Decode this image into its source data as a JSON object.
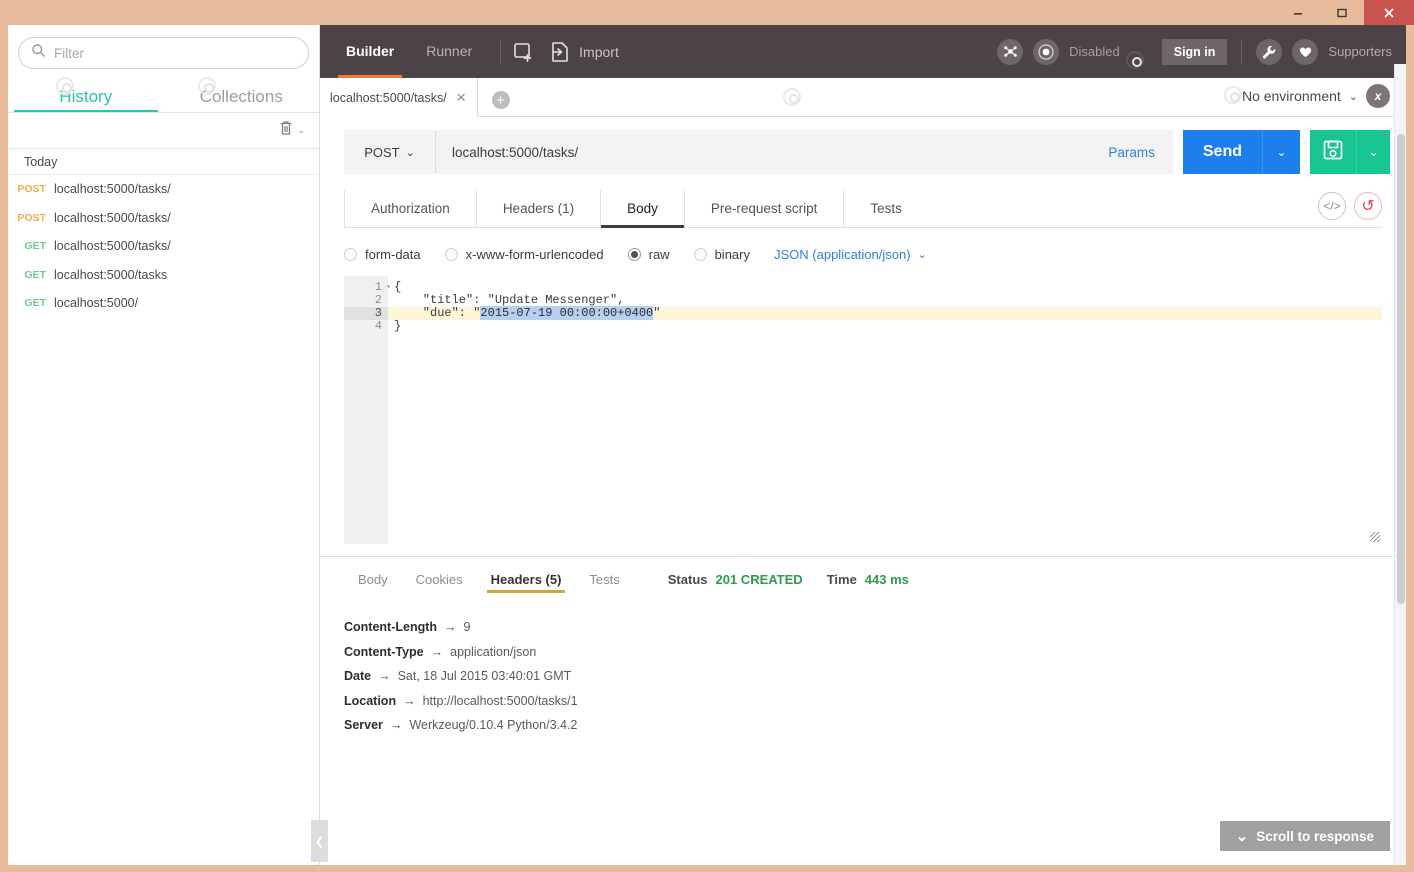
{
  "window": {
    "minimize": "–",
    "maximize": "□",
    "close": "✕"
  },
  "sidebar": {
    "filter": {
      "placeholder": "Filter",
      "value": "",
      "icon": "search-icon"
    },
    "tabs": [
      {
        "label": "History",
        "active": true
      },
      {
        "label": "Collections",
        "active": false
      }
    ],
    "toolbar": {
      "trash_icon": "trash-icon",
      "caret": "⌄"
    },
    "group_label": "Today",
    "history": [
      {
        "method": "POST",
        "url": "localhost:5000/tasks/"
      },
      {
        "method": "POST",
        "url": "localhost:5000/tasks/"
      },
      {
        "method": "GET",
        "url": "localhost:5000/tasks/"
      },
      {
        "method": "GET",
        "url": "localhost:5000/tasks"
      },
      {
        "method": "GET",
        "url": "localhost:5000/"
      }
    ],
    "collapse_icon": "❮"
  },
  "topbar": {
    "modes": [
      {
        "label": "Builder",
        "active": true
      },
      {
        "label": "Runner",
        "active": false
      }
    ],
    "new_tab_icon": "new-window-icon",
    "import_icon": "import-icon",
    "import_label": "Import",
    "settings_icon": "settings-icon",
    "sync_icon": "sync-icon",
    "disabled_label": "Disabled",
    "signin_label": "Sign in",
    "wrench_icon": "wrench-icon",
    "heart_icon": "heart-icon",
    "supporters_label": "Supporters"
  },
  "tabstrip": {
    "tab_title": "localhost:5000/tasks/",
    "close_icon": "✕",
    "new_tab_plus": "+",
    "environment": "No environment",
    "env_caret": "⌄",
    "env_eye_icon": "eye-icon"
  },
  "request": {
    "method": "POST",
    "method_caret": "⌄",
    "url": "localhost:5000/tasks/",
    "params_label": "Params",
    "send_label": "Send",
    "send_caret": "⌄",
    "save_icon": "save-icon",
    "save_caret": "⌄",
    "tabs": [
      {
        "label": "Authorization",
        "active": false
      },
      {
        "label": "Headers (1)",
        "active": false
      },
      {
        "label": "Body",
        "active": true
      },
      {
        "label": "Pre-request script",
        "active": false
      },
      {
        "label": "Tests",
        "active": false
      }
    ],
    "code_icon": "code-icon",
    "reset_icon": "undo-icon",
    "body_types": [
      {
        "label": "form-data",
        "checked": false
      },
      {
        "label": "x-www-form-urlencoded",
        "checked": false
      },
      {
        "label": "raw",
        "checked": true
      },
      {
        "label": "binary",
        "checked": false
      }
    ],
    "content_type": "JSON (application/json)",
    "content_type_caret": "⌄",
    "editor": {
      "lines": [
        {
          "number": "1",
          "fold": "▾",
          "text": "{",
          "active": false
        },
        {
          "number": "2",
          "fold": "",
          "text": "    \"title\": \"Update Messenger\",",
          "active": false
        },
        {
          "number": "3",
          "fold": "",
          "text": "",
          "active": true
        },
        {
          "number": "4",
          "fold": "",
          "text": "}",
          "active": false
        }
      ],
      "line3_prefix": "    \"due\": \"",
      "line3_selected": "2015-07-19 00:00:00+0400",
      "line3_suffix": "\""
    }
  },
  "response": {
    "tabs": [
      {
        "label": "Body",
        "active": false
      },
      {
        "label": "Cookies",
        "active": false
      },
      {
        "label": "Headers (5)",
        "active": true
      },
      {
        "label": "Tests",
        "active": false
      }
    ],
    "status_label": "Status",
    "status_value": "201 CREATED",
    "time_label": "Time",
    "time_value": "443 ms",
    "headers": [
      {
        "key": "Content-Length",
        "arrow": "→",
        "value": "9"
      },
      {
        "key": "Content-Type",
        "arrow": "→",
        "value": "application/json"
      },
      {
        "key": "Date",
        "arrow": "→",
        "value": "Sat, 18 Jul 2015 03:40:01 GMT"
      },
      {
        "key": "Location",
        "arrow": "→",
        "value": "http://localhost:5000/tasks/1"
      },
      {
        "key": "Server",
        "arrow": "→",
        "value": "Werkzeug/0.10.4 Python/3.4.2"
      }
    ],
    "scroll_button": "Scroll to response",
    "scroll_caret": "⌄"
  },
  "colors": {
    "accent_orange": "#f27935",
    "teal": "#2cc4a8",
    "blue": "#1d7fec",
    "green": "#17c492",
    "status_green": "#2d9c4e",
    "gold": "#d2a63c",
    "topbar": "#4b4348",
    "chrome": "#e8bb9c"
  }
}
